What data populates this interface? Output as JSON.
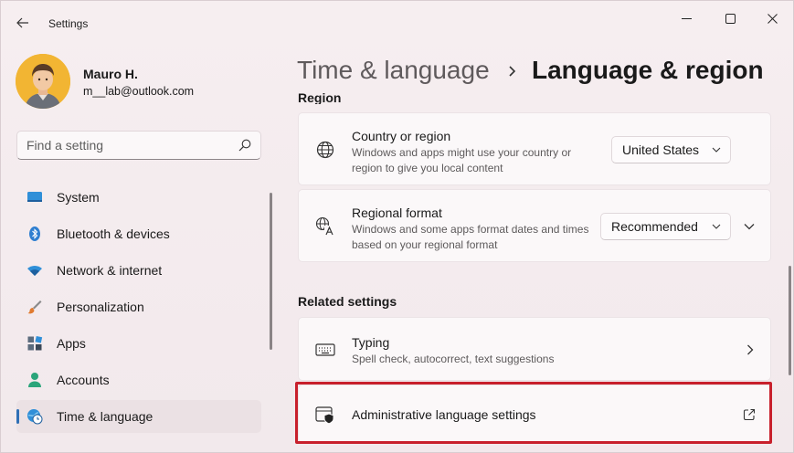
{
  "window": {
    "title": "Settings",
    "controls": [
      "minimize",
      "maximize",
      "close"
    ]
  },
  "profile": {
    "name": "Mauro H.",
    "email": "m__lab@outlook.com"
  },
  "search": {
    "placeholder": "Find a setting"
  },
  "sidebar": {
    "items": [
      {
        "label": "System",
        "icon": "system-icon"
      },
      {
        "label": "Bluetooth & devices",
        "icon": "bluetooth-icon"
      },
      {
        "label": "Network & internet",
        "icon": "wifi-icon"
      },
      {
        "label": "Personalization",
        "icon": "brush-icon"
      },
      {
        "label": "Apps",
        "icon": "apps-icon"
      },
      {
        "label": "Accounts",
        "icon": "person-icon"
      },
      {
        "label": "Time & language",
        "icon": "clock-globe-icon",
        "active": true
      }
    ]
  },
  "header": {
    "parent": "Time & language",
    "current": "Language & region"
  },
  "region_section": {
    "label": "Region",
    "country": {
      "title": "Country or region",
      "desc": "Windows and apps might use your country or region to give you local content",
      "value": "United States"
    },
    "format": {
      "title": "Regional format",
      "desc": "Windows and some apps format dates and times based on your regional format",
      "value": "Recommended"
    }
  },
  "related": {
    "label": "Related settings",
    "typing": {
      "title": "Typing",
      "desc": "Spell check, autocorrect, text suggestions"
    },
    "admin": {
      "title": "Administrative language settings"
    }
  },
  "colors": {
    "accent": "#2f6fb5",
    "highlight_box": "#c8202c",
    "window_bg": "#f3e9ec",
    "card_bg": "#fbf8f9"
  }
}
